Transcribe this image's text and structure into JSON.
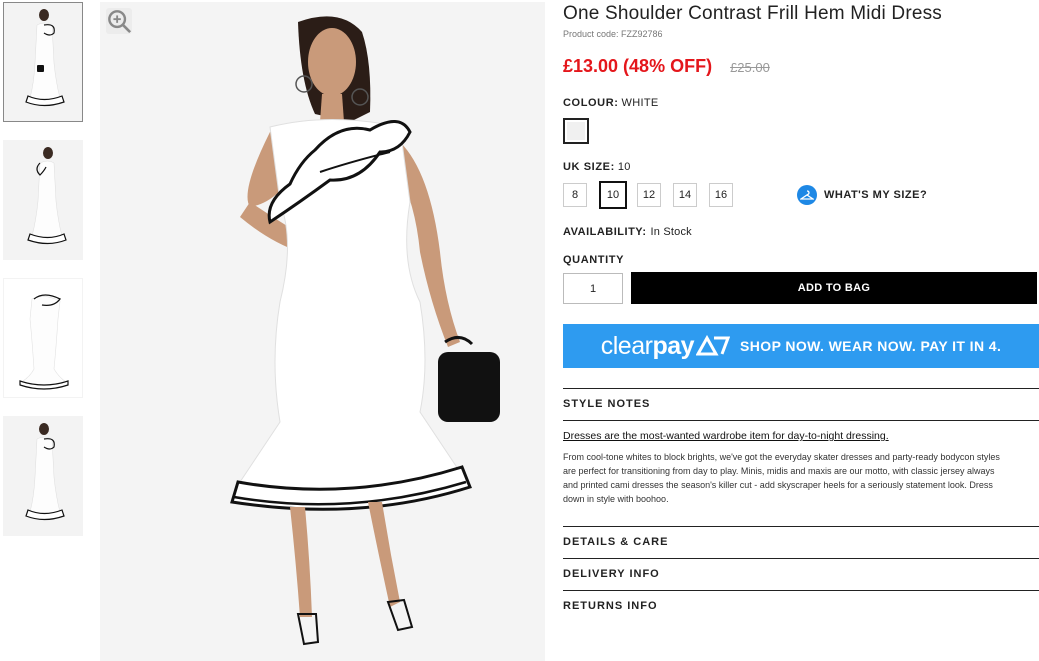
{
  "product": {
    "title": "One Shoulder Contrast Frill Hem Midi Dress",
    "code": "Product code: FZZ92786",
    "price": "£13.00 (48% OFF)",
    "old_price": "£25.00"
  },
  "colour": {
    "label": "COLOUR:",
    "value": "WHITE"
  },
  "size": {
    "label": "UK SIZE:",
    "value": "10",
    "options": [
      "8",
      "10",
      "12",
      "14",
      "16"
    ],
    "guide": "WHAT'S MY SIZE?"
  },
  "availability": {
    "label": "AVAILABILITY:",
    "value": "In Stock"
  },
  "quantity": {
    "label": "QUANTITY",
    "value": "1"
  },
  "cart": {
    "add_label": "ADD TO BAG"
  },
  "clearpay": {
    "logo_a": "clear",
    "logo_b": "pay",
    "tagline": "SHOP NOW. WEAR NOW. PAY IT IN 4."
  },
  "sections": {
    "style_notes": "STYLE NOTES",
    "details": "DETAILS & CARE",
    "delivery": "DELIVERY INFO",
    "returns": "RETURNS INFO"
  },
  "notes": {
    "headline": "Dresses are the most-wanted wardrobe item for day-to-night dressing.",
    "lines": [
      "From cool-tone whites to block brights, we've got the everyday skater dresses and party-ready bodycon styles",
      "are perfect for transitioning from day to play. Minis, midis and maxis are our motto, with classic jersey always",
      "and printed cami dresses the season's killer cut - add skyscraper heels for a seriously statement look. Dress",
      "down in style with boohoo."
    ]
  },
  "colors": {
    "price_red": "#e4161b",
    "clearpay_blue": "#2e9bf0",
    "button_black": "#000000"
  },
  "icons": {
    "zoom": "zoom-in-icon",
    "size_guide": "hanger-icon"
  }
}
